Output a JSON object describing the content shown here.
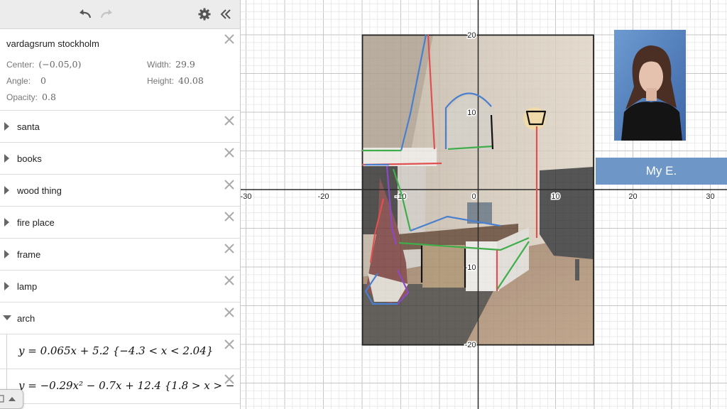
{
  "toolbar": {
    "undo_icon": "undo-icon",
    "redo_icon": "redo-icon",
    "settings_icon": "gear-icon",
    "collapse_icon": "double-chevron-left-icon"
  },
  "image_item": {
    "title": "vardagsrum stockholm",
    "center_label": "Center:",
    "center_value": "(−0.05,0)",
    "width_label": "Width:",
    "width_value": "29.9",
    "angle_label": "Angle:",
    "angle_value": "0",
    "height_label": "Height:",
    "height_value": "40.08",
    "opacity_label": "Opacity:",
    "opacity_value": "0.8"
  },
  "folders": [
    {
      "label": "santa",
      "expanded": false
    },
    {
      "label": "books",
      "expanded": false
    },
    {
      "label": "wood thing",
      "expanded": false
    },
    {
      "label": "fire place",
      "expanded": false
    },
    {
      "label": "frame",
      "expanded": false
    },
    {
      "label": "lamp",
      "expanded": false
    },
    {
      "label": "arch",
      "expanded": true
    }
  ],
  "expressions": [
    {
      "text": "y = 0.065x + 5.2 {−4.3 < x < 2.04}"
    },
    {
      "text": "y = −0.29x² − 0.7x + 12.4 {1.8 > x > −"
    }
  ],
  "graph": {
    "x_tick_labels": [
      "-30",
      "-20",
      "-10",
      "0",
      "10",
      "20",
      "30"
    ],
    "y_tick_labels": [
      "20",
      "10",
      "-10",
      "-20"
    ],
    "image_x_range": [
      -15,
      15
    ],
    "image_y_range": [
      -20,
      20
    ],
    "colors": {
      "grid_minor": "#e6e6e6",
      "grid_major": "#c6c6c6",
      "axis": "#2b2b2b",
      "blue": "#4a7fd0",
      "red": "#e05050",
      "green": "#3fae4a",
      "black": "#111111",
      "purple": "#8a4ac8"
    }
  },
  "side_label": {
    "text": "My E.",
    "color": "#6e97c8"
  }
}
